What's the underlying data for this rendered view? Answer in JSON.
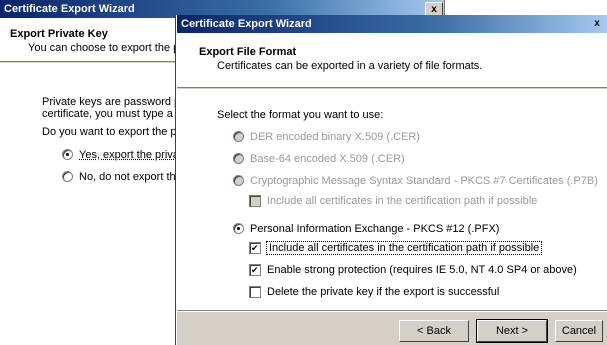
{
  "back_window": {
    "title": "Certificate Export Wizard",
    "close_label": "x",
    "header_title": "Export Private Key",
    "header_sub": "You can choose to export the p",
    "intro_line1": "Private keys are password prote",
    "intro_line2": "certificate, you must type a pas",
    "question": "Do you want to export the priva",
    "option_yes": "Yes, export the private",
    "option_no": "No, do not export the p"
  },
  "front_window": {
    "title": "Certificate Export Wizard",
    "close_label": "x",
    "header_title": "Export File Format",
    "header_sub": "Certificates can be exported in a variety of file formats.",
    "select_prompt": "Select the format you want to use:",
    "formats": [
      {
        "label": "DER encoded binary X.509 (.CER)",
        "checked": false,
        "enabled": false
      },
      {
        "label": "Base-64 encoded X.509 (.CER)",
        "checked": false,
        "enabled": false
      },
      {
        "label": "Cryptographic Message Syntax Standard - PKCS #7 Certificates (.P7B)",
        "checked": false,
        "enabled": false
      },
      {
        "label": "Personal Information Exchange - PKCS #12 (.PFX)",
        "checked": true,
        "enabled": true
      }
    ],
    "p7b_option": {
      "label": "Include all certificates in the certification path if possible",
      "checked": false,
      "enabled": false
    },
    "pfx_options": [
      {
        "label": "Include all certificates in the certification path if possible",
        "checked": true
      },
      {
        "label": "Enable strong protection (requires IE 5.0, NT 4.0 SP4 or above)",
        "checked": true
      },
      {
        "label": "Delete the private key if the export is successful",
        "checked": false
      }
    ],
    "buttons": {
      "back": "< Back",
      "next": "Next >",
      "cancel": "Cancel"
    }
  }
}
